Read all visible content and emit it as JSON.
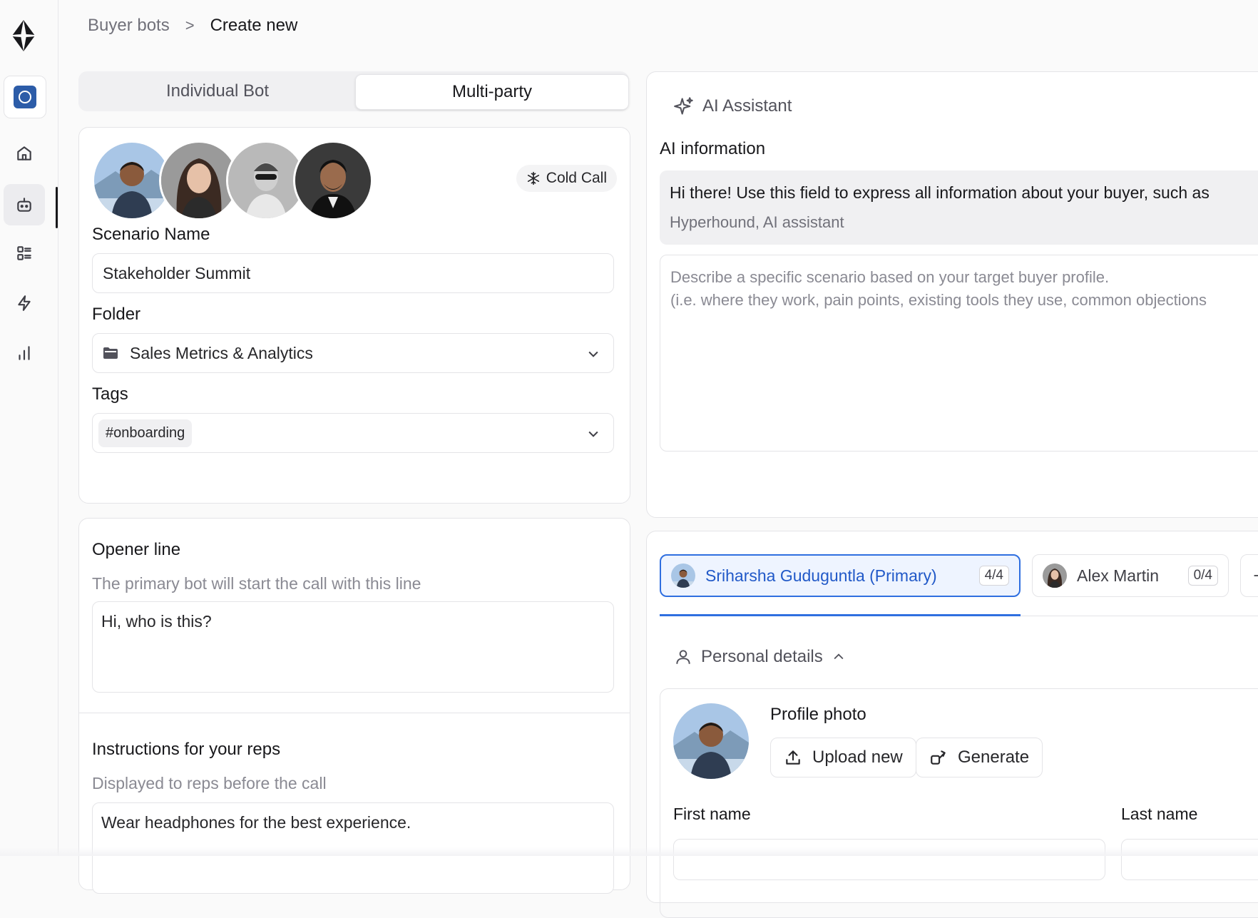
{
  "breadcrumb": {
    "parent": "Buyer bots",
    "separator": ">",
    "current": "Create new"
  },
  "sidebar": {
    "items": [
      {
        "name": "workspace",
        "icon": "workspace-icon"
      },
      {
        "name": "home",
        "icon": "home-icon"
      },
      {
        "name": "bots",
        "icon": "bot-icon",
        "active": true
      },
      {
        "name": "lists",
        "icon": "list-icon"
      },
      {
        "name": "flash",
        "icon": "lightning-icon"
      },
      {
        "name": "analytics",
        "icon": "bar-chart-icon"
      }
    ]
  },
  "mode_tabs": {
    "individual": "Individual Bot",
    "multiparty": "Multi-party",
    "selected": "Multi-party"
  },
  "scenario": {
    "badge": "Cold Call",
    "name_label": "Scenario Name",
    "name_value": "Stakeholder Summit",
    "folder_label": "Folder",
    "folder_value": "Sales Metrics & Analytics",
    "tags_label": "Tags",
    "tag": "#onboarding"
  },
  "opener": {
    "title": "Opener line",
    "subtitle": "The primary bot will start the call with this line",
    "value": "Hi, who is this?"
  },
  "instructions": {
    "title": "Instructions for your reps",
    "subtitle": "Displayed to reps before the call",
    "value": "Wear headphones for the best experience."
  },
  "ai": {
    "header": "AI Assistant",
    "info_label": "AI information",
    "message": "Hi there! Use this field to express all information about your buyer, such as",
    "author": "Hyperhound, AI assistant",
    "placeholder_line1": "Describe a specific scenario based on your target buyer profile.",
    "placeholder_line2": "(i.e. where they work, pain points, existing tools they use, common objections"
  },
  "bots": {
    "tabs": [
      {
        "name": "Sriharsha Guduguntla (Primary)",
        "count": "4/4"
      },
      {
        "name": "Alex Martin",
        "count": "0/4"
      }
    ]
  },
  "personal": {
    "header": "Personal details",
    "photo_label": "Profile photo",
    "upload": "Upload new",
    "generate": "Generate",
    "first_name_label": "First name",
    "last_name_label": "Last name"
  },
  "colors": {
    "accent": "#2f6fe0",
    "workspace": "#2c5ca8"
  }
}
